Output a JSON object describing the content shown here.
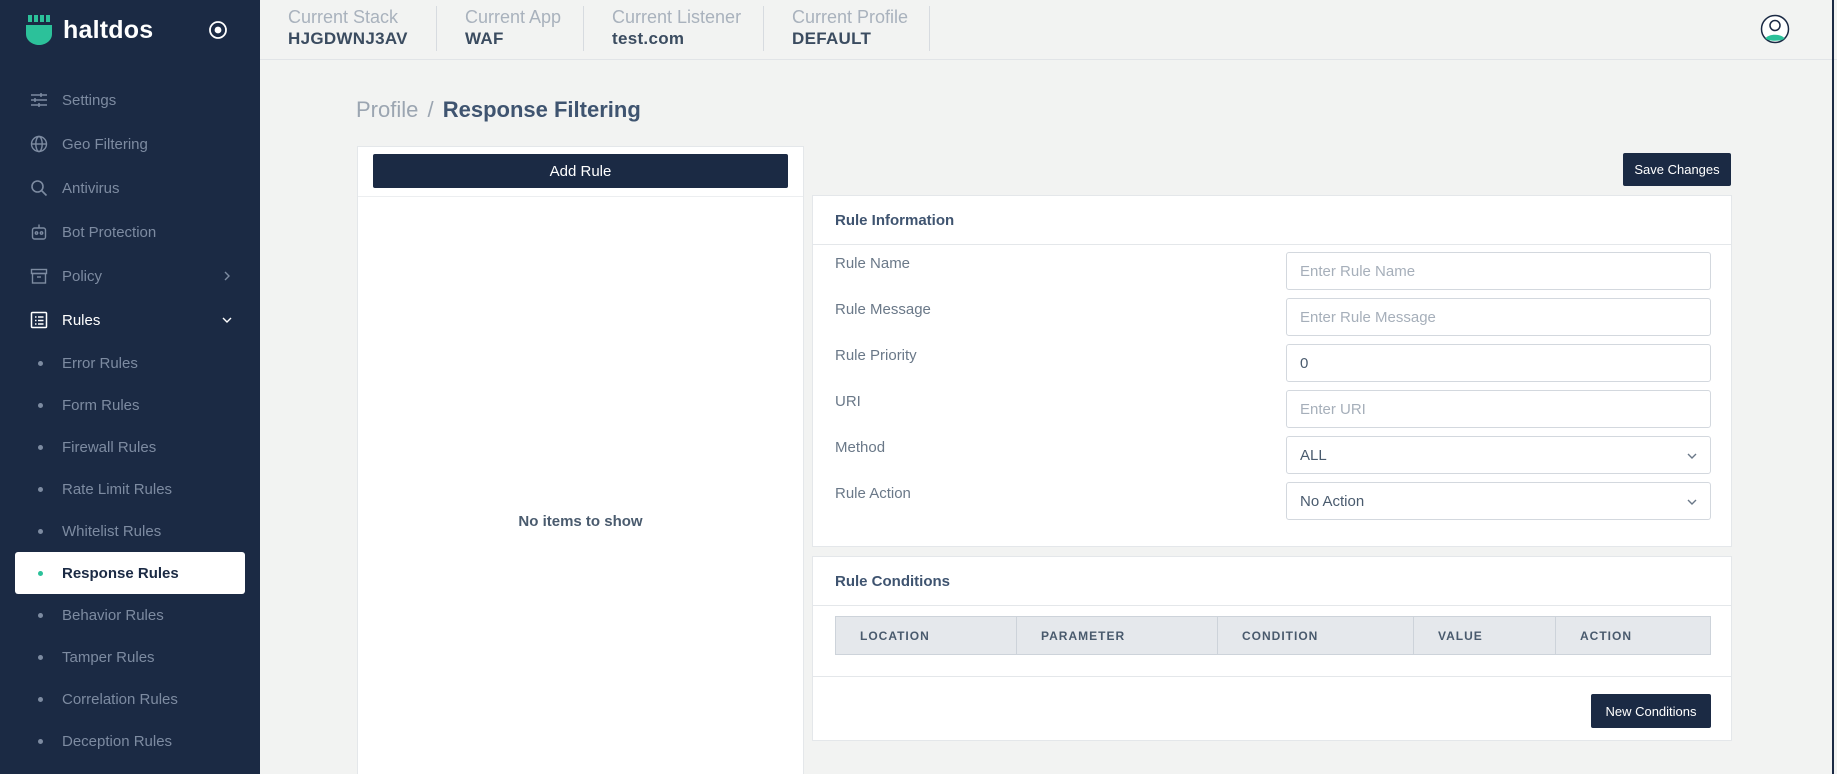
{
  "brand": {
    "name": "haltdos"
  },
  "colors": {
    "sidebar": "#1b2a44",
    "accent": "#2cc19a",
    "background": "#f2f3f2"
  },
  "sidebar": {
    "items": [
      {
        "label": "Settings",
        "icon": "sliders-icon"
      },
      {
        "label": "Geo Filtering",
        "icon": "globe-icon"
      },
      {
        "label": "Antivirus",
        "icon": "search-icon"
      },
      {
        "label": "Bot Protection",
        "icon": "robot-icon"
      },
      {
        "label": "Policy",
        "icon": "archive-icon"
      },
      {
        "label": "Rules",
        "icon": "list-icon"
      }
    ],
    "rules_sub": [
      "Error Rules",
      "Form Rules",
      "Firewall Rules",
      "Rate Limit Rules",
      "Whitelist Rules",
      "Response Rules",
      "Behavior Rules",
      "Tamper Rules",
      "Correlation Rules",
      "Deception Rules"
    ],
    "active_sub": "Response Rules"
  },
  "topbar": {
    "stack": {
      "label": "Current Stack",
      "value": "HJGDWNJ3AV"
    },
    "app": {
      "label": "Current App",
      "value": "WAF"
    },
    "listener": {
      "label": "Current Listener",
      "value": "test.com"
    },
    "profile": {
      "label": "Current Profile",
      "value": "DEFAULT"
    }
  },
  "breadcrumb": {
    "parent": "Profile",
    "separator": "/",
    "current": "Response Filtering"
  },
  "left_panel": {
    "add_rule_label": "Add Rule",
    "empty_text": "No items to show"
  },
  "save_label": "Save Changes",
  "rule_info": {
    "title": "Rule Information",
    "rule_name": {
      "label": "Rule Name",
      "placeholder": "Enter Rule Name"
    },
    "rule_message": {
      "label": "Rule Message",
      "placeholder": "Enter Rule Message"
    },
    "rule_priority": {
      "label": "Rule Priority",
      "value": "0"
    },
    "uri": {
      "label": "URI",
      "placeholder": "Enter URI"
    },
    "method": {
      "label": "Method",
      "value": "ALL"
    },
    "rule_action": {
      "label": "Rule Action",
      "value": "No Action"
    }
  },
  "rule_conditions": {
    "title": "Rule Conditions",
    "columns": [
      "LOCATION",
      "PARAMETER",
      "CONDITION",
      "VALUE",
      "ACTION"
    ],
    "new_label": "New Conditions"
  }
}
